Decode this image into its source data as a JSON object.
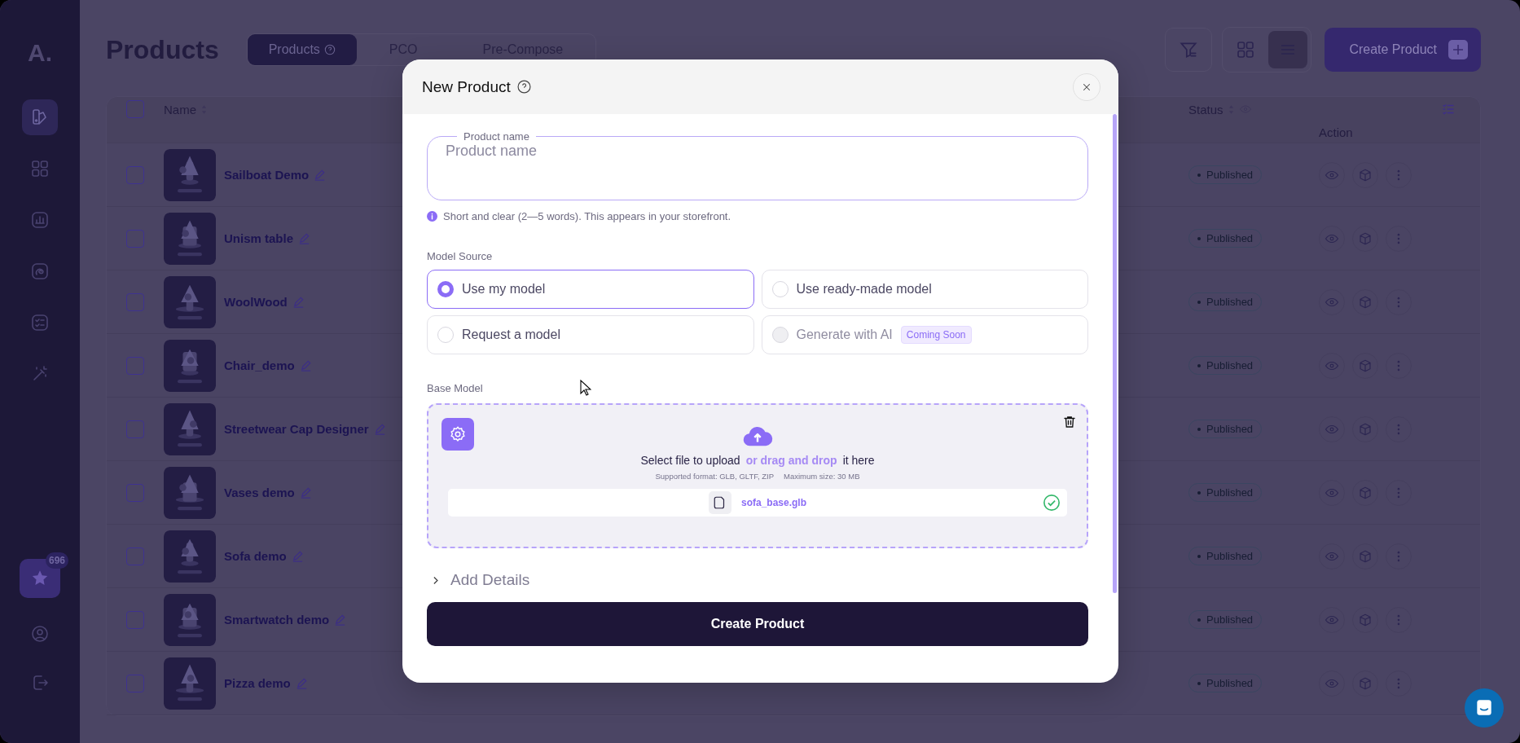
{
  "sidebar": {
    "logo": "A.",
    "nav": [
      {
        "kind": "swatch",
        "selected": true
      },
      {
        "kind": "grid",
        "selected": false
      },
      {
        "kind": "chart",
        "selected": false
      },
      {
        "kind": "spiral",
        "selected": false
      },
      {
        "kind": "checklist",
        "selected": false
      },
      {
        "kind": "wand",
        "selected": false
      }
    ],
    "credits": {
      "badge": "696"
    },
    "bottom": [
      {
        "kind": "user"
      },
      {
        "kind": "logout"
      }
    ]
  },
  "header": {
    "title": "Products",
    "tabs": [
      {
        "label": "Products",
        "selected": true,
        "help": true
      },
      {
        "label": "PCO",
        "selected": false,
        "help": false
      },
      {
        "label": "Pre-Compose",
        "selected": false,
        "help": false
      }
    ],
    "views": [
      {
        "kind": "grid",
        "selected": false
      },
      {
        "kind": "list",
        "selected": true
      }
    ],
    "create_button": "Create Product"
  },
  "table": {
    "all_checked": false,
    "columns": [
      {
        "label": "Name",
        "sortable": true,
        "eye": false
      },
      {
        "label": "Status",
        "sortable": true,
        "eye": true
      },
      {
        "label": "Action",
        "sortable": false,
        "eye": false
      }
    ],
    "rows": [
      {
        "name": "Sailboat Demo",
        "status": "Published",
        "checked": false
      },
      {
        "name": "Unism table",
        "status": "Published",
        "checked": false
      },
      {
        "name": "WoolWood",
        "status": "Published",
        "checked": false
      },
      {
        "name": "Chair_demo",
        "status": "Published",
        "checked": false
      },
      {
        "name": "Streetwear Cap Designer",
        "status": "Published",
        "checked": false
      },
      {
        "name": "Vases demo",
        "status": "Published",
        "checked": false
      },
      {
        "name": "Sofa demo",
        "status": "Published",
        "checked": false
      },
      {
        "name": "Smartwatch demo",
        "status": "Published",
        "checked": false
      },
      {
        "name": "Pizza demo",
        "status": "Published",
        "checked": false
      }
    ]
  },
  "modal": {
    "title": "New Product",
    "name_field": {
      "legend": "Product name",
      "placeholder": "Product name"
    },
    "hint": "Short and clear (2—5 words). This appears in your storefront.",
    "model_source": {
      "label": "Model Source",
      "options": [
        {
          "label": "Use my model",
          "selected": true,
          "disabled": false
        },
        {
          "label": "Use ready-made model",
          "selected": false,
          "disabled": false
        },
        {
          "label": "Request a model",
          "selected": false,
          "disabled": false
        },
        {
          "label": "Generate with AI",
          "selected": false,
          "disabled": true,
          "badge": "Coming Soon"
        }
      ]
    },
    "base_model": {
      "label": "Base Model",
      "prompt": "Select file to upload",
      "link": "or drag and drop",
      "suffix": "it here",
      "formats": "Supported format: GLB, GLTF, ZIP",
      "max_size": "Maximum size: 30 MB",
      "file": {
        "name": "sofa_base.glb",
        "verified": true
      }
    },
    "add_details": {
      "label": "Add Details",
      "expanded": false
    },
    "submit": "Create Product"
  }
}
